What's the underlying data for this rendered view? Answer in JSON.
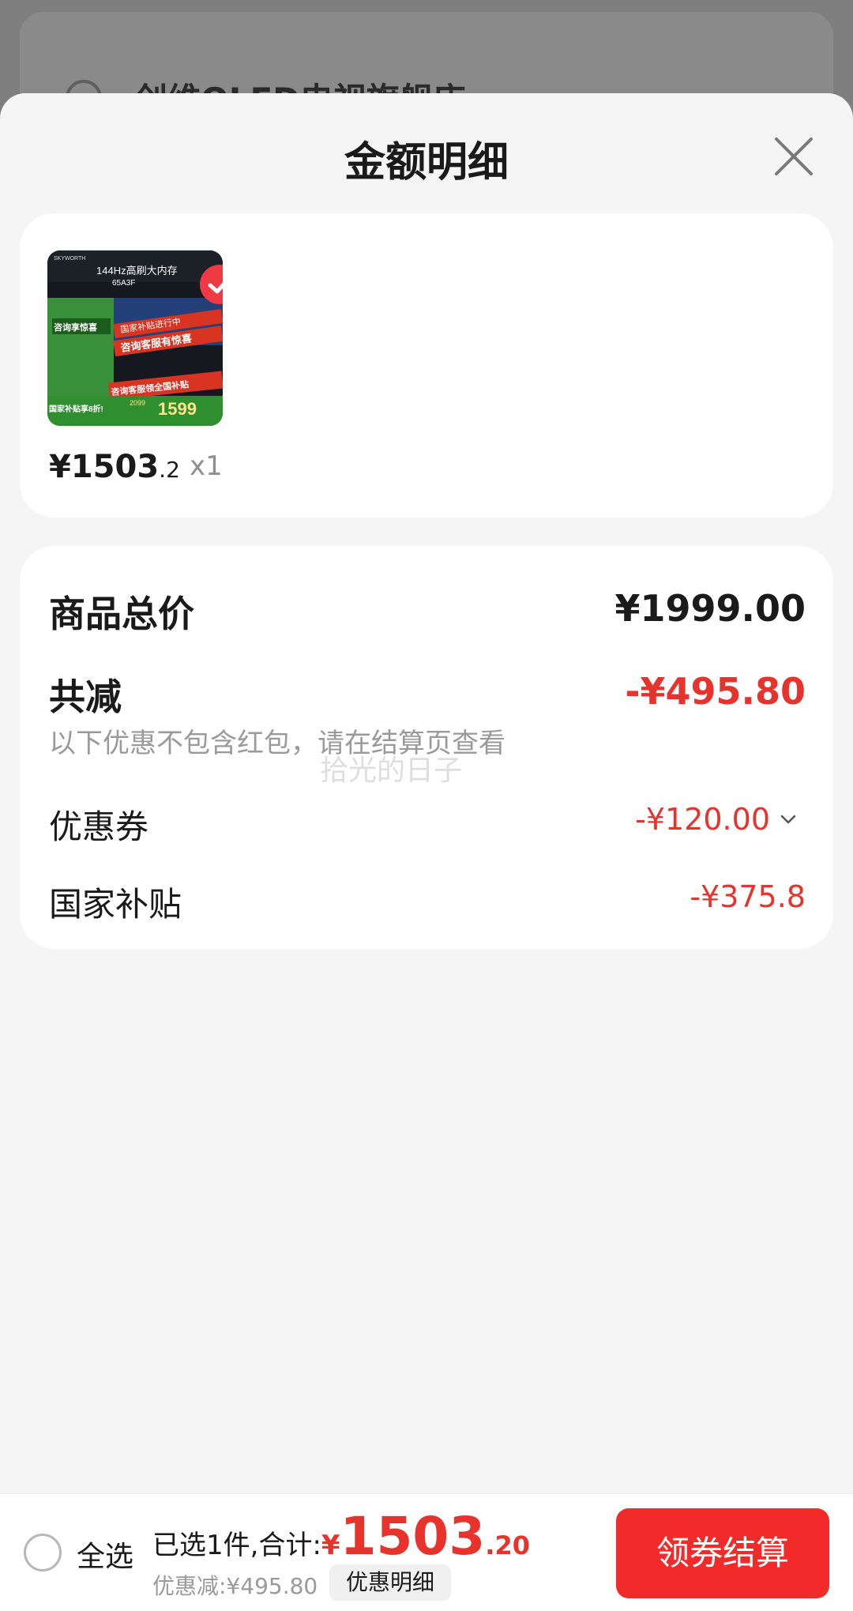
{
  "background": {
    "store_name": "创维OLED电视旗舰店 ›"
  },
  "sheet": {
    "title": "金额明细",
    "close_icon": "close-icon"
  },
  "product": {
    "image_texts": {
      "brand": "SKYWORTH",
      "headline": "144Hz高刷大内存",
      "model": "65A3F",
      "subsidy_banner": "国家补贴进行中",
      "consult_banner": "咨询客服有惊喜",
      "bottom_banner": "咨询客服领全国补贴",
      "side_tag": "咨询享惊喜",
      "discount_tag": "国家补贴享8折!",
      "old_price": "2099",
      "new_price": "1599"
    },
    "price_symbol": "¥",
    "price_int": "1503",
    "price_dec": ".2",
    "quantity": "x1"
  },
  "summary": {
    "total_label": "商品总价",
    "total_value": "¥1999.00",
    "reduce_label": "共减",
    "reduce_value": "-¥495.80",
    "note": "以下优惠不包含红包，请在结算页查看",
    "watermark": "拾光的日子",
    "coupon_label": "优惠券",
    "coupon_value": "-¥120.00",
    "subsidy_label": "国家补贴",
    "subsidy_value": "-¥375.8"
  },
  "bottom_bar": {
    "select_all": "全选",
    "selected_text": "已选1件,合计:",
    "total_yen": "¥",
    "total_int": "1503",
    "total_dec": ".20",
    "discount_text": "优惠减:¥495.80",
    "detail_button": "优惠明细",
    "checkout_button": "领券结算"
  },
  "colors": {
    "accent_red": "#e8322c",
    "button_red": "#f22a2a",
    "sheet_bg": "#f5f5f5"
  }
}
